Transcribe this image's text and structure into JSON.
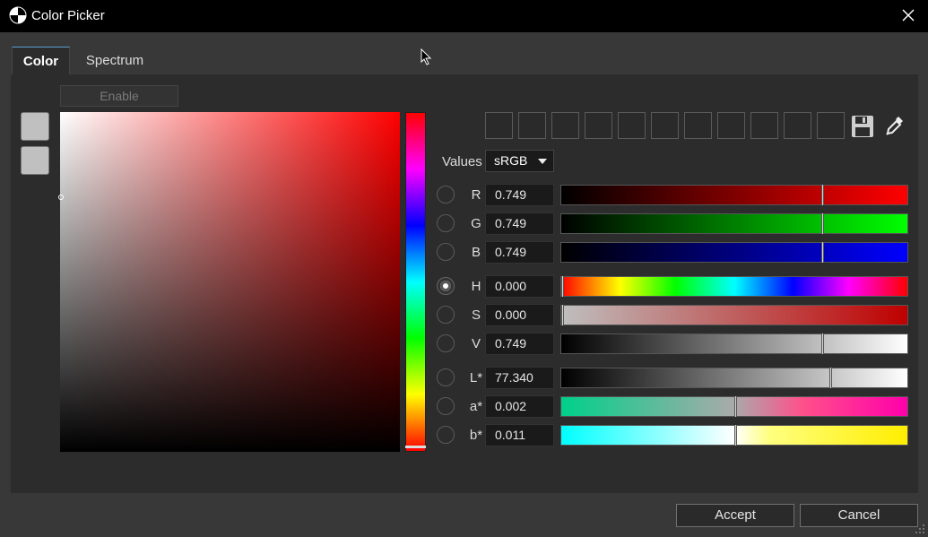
{
  "window": {
    "title": "Color Picker",
    "icon": "color-wheel-icon",
    "close_icon": "close-icon"
  },
  "tabs": [
    {
      "label": "Color",
      "active": true
    },
    {
      "label": "Spectrum",
      "active": false
    }
  ],
  "enable_label": "Enable",
  "values_label": "Values",
  "color_space": "sRGB",
  "channels": [
    {
      "label": "R",
      "value": "0.749",
      "level": 0.749,
      "selected": false
    },
    {
      "label": "G",
      "value": "0.749",
      "level": 0.749,
      "selected": false
    },
    {
      "label": "B",
      "value": "0.749",
      "level": 0.749,
      "selected": false
    },
    {
      "label": "H",
      "value": "0.000",
      "level": 0.0,
      "selected": true
    },
    {
      "label": "S",
      "value": "0.000",
      "level": 0.0,
      "selected": false
    },
    {
      "label": "V",
      "value": "0.749",
      "level": 0.749,
      "selected": false
    },
    {
      "label": "L*",
      "value": "77.340",
      "level": 0.773,
      "selected": false
    },
    {
      "label": "a*",
      "value": "0.002",
      "level": 0.5,
      "selected": false
    },
    {
      "label": "b*",
      "value": "0.011",
      "level": 0.5,
      "selected": false
    }
  ],
  "current_color": "#bfbfbf",
  "previous_color": "#bfbfbf",
  "preset_count": 11,
  "icons": {
    "save": "save-icon",
    "eyedropper": "eyedropper-icon"
  },
  "buttons": {
    "accept": "Accept",
    "cancel": "Cancel"
  }
}
